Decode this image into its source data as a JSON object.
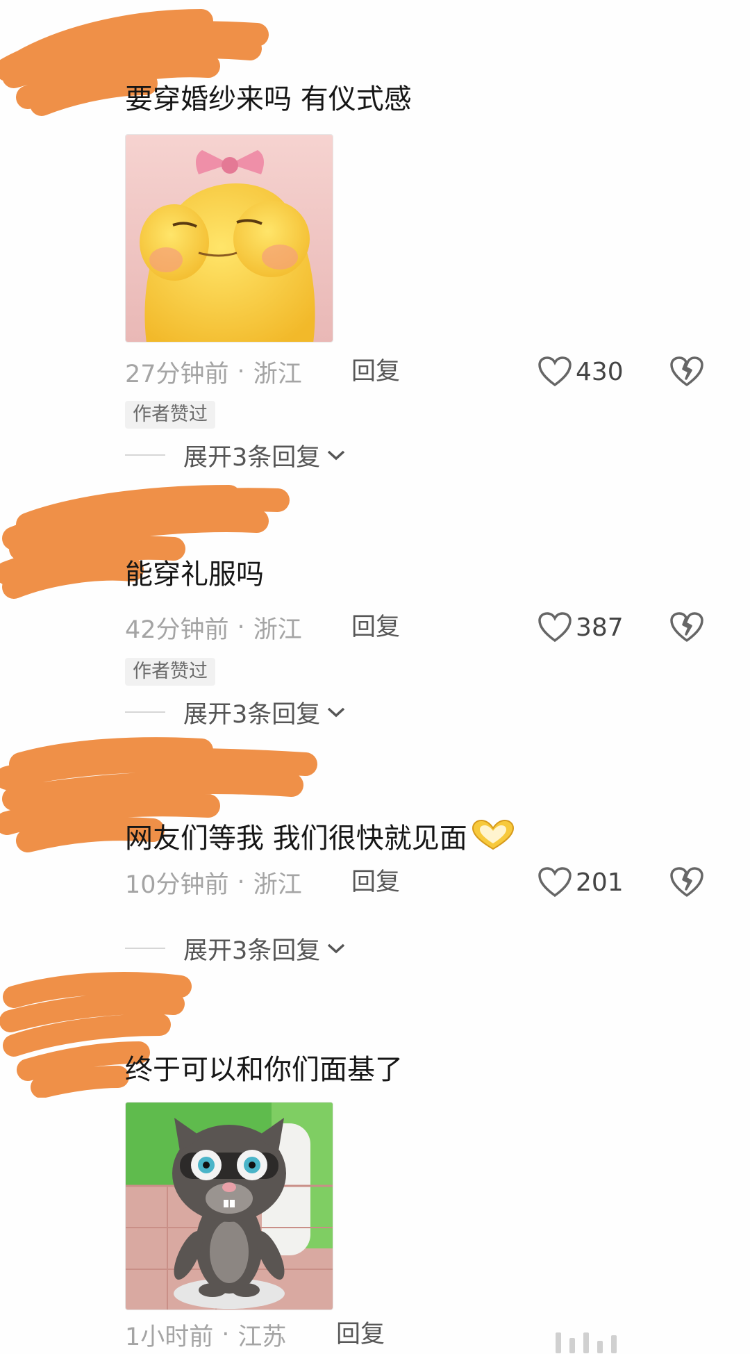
{
  "colors": {
    "scribble": "#ef9048",
    "text": "#161616",
    "meta": "#a4a4a4",
    "badge_bg": "#f1f1f1"
  },
  "comments": [
    {
      "text": "要穿婚纱来吗 有仪式感",
      "has_sticker": true,
      "sticker": "yellow-blob-with-pink-bow",
      "time": "27分钟前",
      "sep": "·",
      "location": "浙江",
      "reply": "回复",
      "likes": "430",
      "badge": "作者赞过",
      "expand": "展开3条回复"
    },
    {
      "text": "能穿礼服吗",
      "has_sticker": false,
      "time": "42分钟前",
      "sep": "·",
      "location": "浙江",
      "reply": "回复",
      "likes": "387",
      "badge": "作者赞过",
      "expand": "展开3条回复"
    },
    {
      "text": "网友们等我 我们很快就见面",
      "emoji": "heart-hands-emoji",
      "has_sticker": false,
      "time": "10分钟前",
      "sep": "·",
      "location": "浙江",
      "reply": "回复",
      "likes": "201",
      "expand": "展开3条回复"
    },
    {
      "text": "终于可以和你们面基了",
      "has_sticker": true,
      "sticker": "talking-tom-cat",
      "time": "1小时前",
      "sep": "·",
      "location": "江苏",
      "reply": "回复"
    }
  ]
}
